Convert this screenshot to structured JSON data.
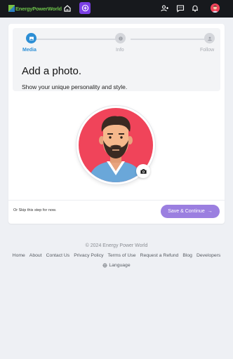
{
  "nav": {
    "brand": "EnergyPowerWorld",
    "icons": [
      "home-icon",
      "create-icon",
      "add-user-icon",
      "messages-icon",
      "notifications-icon",
      "profile-avatar"
    ]
  },
  "stepper": {
    "steps": [
      {
        "label": "Media",
        "state": "active",
        "icon": "image-icon"
      },
      {
        "label": "Info",
        "state": "inactive",
        "icon": "info-icon"
      },
      {
        "label": "Follow",
        "state": "inactive",
        "icon": "user-icon"
      }
    ]
  },
  "main": {
    "headline": "Add a photo.",
    "subline": "Show your unique personality and style.",
    "skip_text": "Or Skip this step for now.",
    "save_label": "Save & Continue"
  },
  "footer": {
    "copyright": "© 2024 Energy Power World",
    "links": [
      "Home",
      "About",
      "Contact Us",
      "Privacy Policy",
      "Terms of Use",
      "Request a Refund",
      "Blog",
      "Developers"
    ],
    "language": "Language"
  },
  "colors": {
    "accent": "#2d8fd5",
    "save_button": "#9b7fe0",
    "create_button": "#7b3fe4",
    "avatar_bg": "#f0445a"
  }
}
